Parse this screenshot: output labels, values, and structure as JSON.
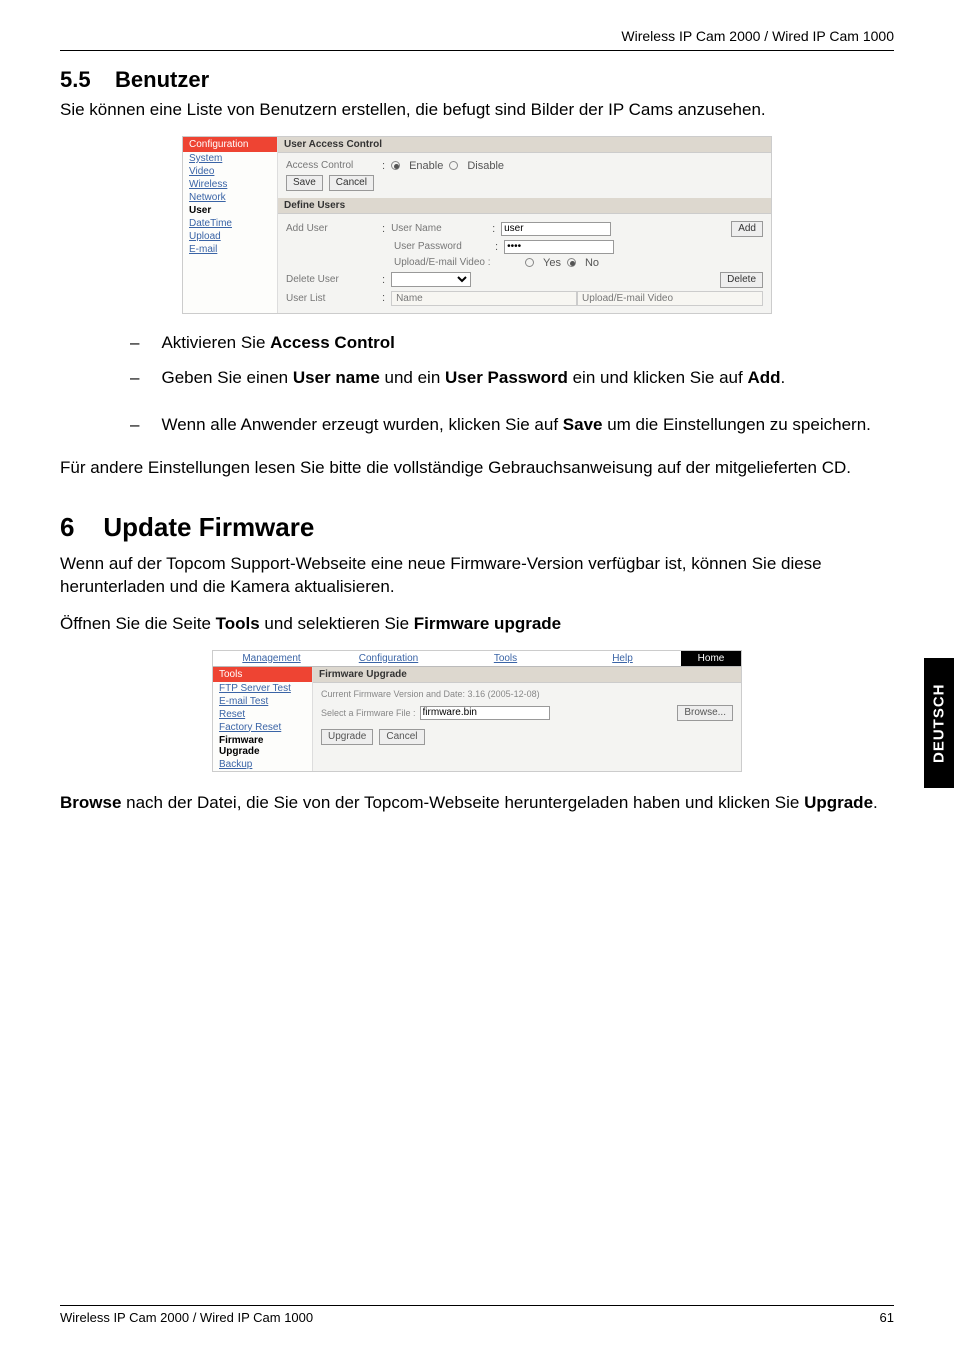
{
  "header": {
    "runhead": "Wireless IP Cam 2000 / Wired IP Cam 1000"
  },
  "section55": {
    "num": "5.5",
    "title": "Benutzer",
    "intro": "Sie können eine Liste von Benutzern erstellen, die befugt sind Bilder der IP Cams anzusehen.",
    "bullets": {
      "b1_pre": "Aktivieren Sie ",
      "b1_s1": "Access Control",
      "b2_pre": "Geben Sie einen ",
      "b2_s1": "User name",
      "b2_mid": " und ein ",
      "b2_s2": "User Password",
      "b2_post1": " ein und klicken Sie auf ",
      "b2_s3": "Add",
      "b2_post2": ".",
      "b3_pre": "Wenn alle Anwender erzeugt wurden, klicken Sie auf ",
      "b3_s1": "Save",
      "b3_post": " um die Einstellungen zu speichern."
    },
    "outro": "Für andere Einstellungen lesen Sie bitte die vollständige Gebrauchsanweisung auf der mitgelieferten CD."
  },
  "section6": {
    "num": "6",
    "title": "Update Firmware",
    "p1": "Wenn auf der Topcom Support-Webseite eine neue Firmware-Version verfügbar ist, können Sie diese herunterladen und die Kamera aktualisieren.",
    "p2_pre": "Öffnen Sie die Seite ",
    "p2_s1": "Tools",
    "p2_mid": " und selektieren Sie ",
    "p2_s2": "Firmware upgrade",
    "p3_s1": "Browse",
    "p3_mid": " nach der Datei, die Sie von der Topcom-Webseite heruntergeladen haben und klicken Sie ",
    "p3_s2": "Upgrade",
    "p3_post": "."
  },
  "sidetab": "DEUTSCH",
  "footer": {
    "left": "Wireless IP Cam 2000 / Wired IP Cam 1000",
    "right": "61"
  },
  "mock1": {
    "side_hdr": "Configuration",
    "nav": {
      "system": "System",
      "video": "Video",
      "wireless": "Wireless",
      "network": "Network",
      "user": "User",
      "datetime": "DateTime",
      "upload": "Upload",
      "email": "E-mail"
    },
    "bar1": "User Access Control",
    "access_lbl": "Access Control",
    "enable": "Enable",
    "disable": "Disable",
    "save": "Save",
    "cancel": "Cancel",
    "bar2": "Define Users",
    "adduser_lbl": "Add User",
    "username_lbl": "User Name",
    "username_val": "user",
    "userpass_lbl": "User Password",
    "userpass_val": "••••",
    "upemail_lbl": "Upload/E-mail Video :",
    "yes": "Yes",
    "no": "No",
    "add_btn": "Add",
    "deluser_lbl": "Delete User",
    "delete_btn": "Delete",
    "userlist_lbl": "User List",
    "th_name": "Name",
    "th_upemail": "Upload/E-mail Video"
  },
  "mock2": {
    "tabs": {
      "mgmt": "Management",
      "conf": "Configuration",
      "tools": "Tools",
      "help": "Help",
      "home": "Home"
    },
    "side_hdr": "Tools",
    "nav": {
      "ftp": "FTP Server Test",
      "email": "E-mail Test",
      "reset": "Reset",
      "factory": "Factory Reset",
      "fw": "Firmware Upgrade",
      "backup": "Backup"
    },
    "bar": "Firmware Upgrade",
    "curfw": "Current Firmware Version and Date: 3.16 (2005-12-08)",
    "sel_lbl": "Select a Firmware File :",
    "sel_val": "firmware.bin",
    "browse": "Browse...",
    "upgrade": "Upgrade",
    "cancel": "Cancel"
  }
}
